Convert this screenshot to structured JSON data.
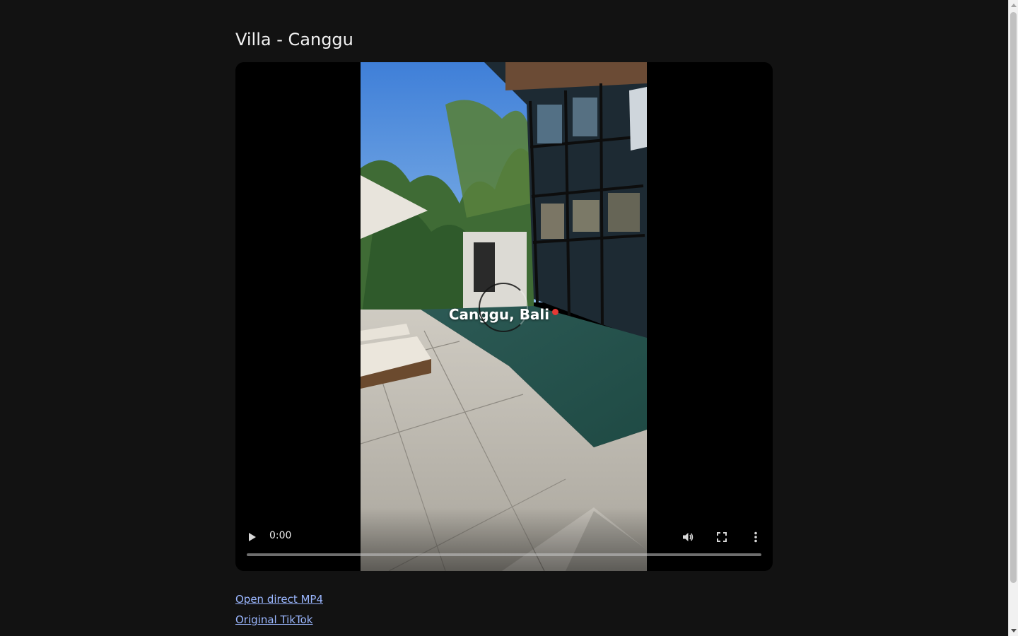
{
  "page": {
    "title": "Villa - Canggu"
  },
  "video": {
    "caption": "Canggu, Bali",
    "current_time": "0:00",
    "progress": 0,
    "colors": {
      "background": "#121212",
      "player": "#000000",
      "link": "#9bb7ff"
    },
    "icons": [
      "play-icon",
      "volume-icon",
      "fullscreen-icon",
      "more-vertical-icon"
    ]
  },
  "links": {
    "direct_mp4": "Open direct MP4",
    "original_tiktok": "Original TikTok"
  }
}
